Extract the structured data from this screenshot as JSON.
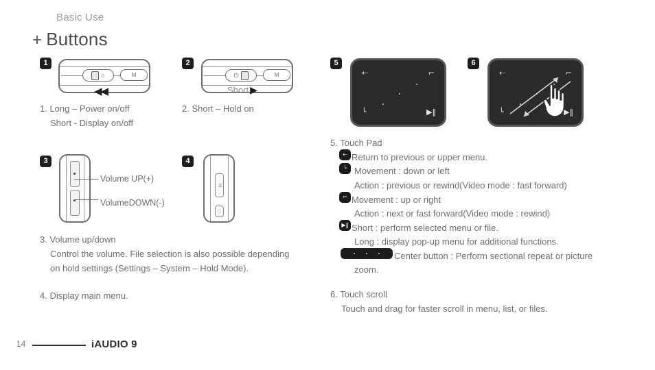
{
  "header": {
    "kicker": "Basic Use",
    "plus": "+",
    "title": "Buttons"
  },
  "badges": {
    "one": "1",
    "two": "2",
    "three": "3",
    "four": "4",
    "five": "5",
    "six": "6"
  },
  "devices": {
    "device1": {
      "lock_glyph": "⌂",
      "m_label": "M",
      "rewind_glyph": "◀◀"
    },
    "device2": {
      "power_glyph": "⏻",
      "m_label": "M",
      "short_label": "Short",
      "play_glyph": "▶"
    },
    "device3": {
      "volume_up_label": "Volume UP(+)",
      "volume_down_label": "VolumeDOWN(-)"
    },
    "device4": {
      "m_label": "M",
      "bottom_glyph": "□"
    }
  },
  "left_column": {
    "item1_line1": "1. Long – Power on/off",
    "item1_line2": "Short - Display on/off",
    "item2_line1": "2. Short – Hold on",
    "item3_line1": "3. Volume up/down",
    "item3_line2": "Control the volume. File selection is also possible depending",
    "item3_line3": "on hold settings (Settings – System – Hold Mode).",
    "item4_line1": "4. Display main menu."
  },
  "touchpad": {
    "icon_back": "⇠",
    "icon_top_right": "⌐",
    "icon_bottom_left": "└",
    "icon_play_pause": "▶‖"
  },
  "right_column": {
    "item5_title": "5. Touch Pad",
    "row_back_text": "Return to previous or upper menu.",
    "row_down_text": "Movement : down or left",
    "row_down_action": "Action : previous or rewind(Video mode : fast forward)",
    "row_up_text": "Movement : up or right",
    "row_up_action": "Action : next or fast forward(Video mode : rewind)",
    "row_short_text": "Short : perform selected menu or file.",
    "row_long_text": "Long : display pop-up menu for additional functions.",
    "row_center_text": "Center button : Perform sectional repeat or picture",
    "row_center_text2": "zoom.",
    "item6_title": "6. Touch scroll",
    "item6_line1": "Touch and drag for faster scroll in menu, list, or files.",
    "key_back_glyph": "⇠",
    "key_down_glyph": "└",
    "key_up_glyph": "⌐",
    "key_short_glyph": "▶‖"
  },
  "footer": {
    "page_number": "14",
    "brand": "iAUDIO 9"
  },
  "colors": {
    "text": "#6f6f6f",
    "title": "#4a4a4a",
    "dark": "#1c1c1c",
    "pad_bg": "#2b2b2b",
    "pad_border": "#575757"
  }
}
